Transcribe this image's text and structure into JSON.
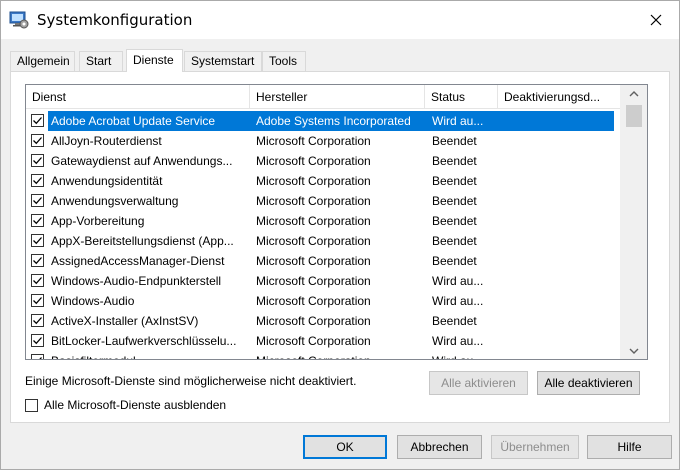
{
  "window": {
    "title": "Systemkonfiguration"
  },
  "tabs": [
    {
      "label": "Allgemein"
    },
    {
      "label": "Start"
    },
    {
      "label": "Dienste"
    },
    {
      "label": "Systemstart"
    },
    {
      "label": "Tools"
    }
  ],
  "active_tab": "Dienste",
  "services": {
    "columns": [
      "Dienst",
      "Hersteller",
      "Status",
      "Deaktivierungsd..."
    ],
    "rows": [
      {
        "name": "Adobe Acrobat Update Service",
        "vendor": "Adobe Systems Incorporated",
        "status": "Wird au...",
        "checked": true,
        "selected": true
      },
      {
        "name": "AllJoyn-Routerdienst",
        "vendor": "Microsoft Corporation",
        "status": "Beendet",
        "checked": true
      },
      {
        "name": "Gatewaydienst auf Anwendungs...",
        "vendor": "Microsoft Corporation",
        "status": "Beendet",
        "checked": true
      },
      {
        "name": "Anwendungsidentität",
        "vendor": "Microsoft Corporation",
        "status": "Beendet",
        "checked": true
      },
      {
        "name": "Anwendungsverwaltung",
        "vendor": "Microsoft Corporation",
        "status": "Beendet",
        "checked": true
      },
      {
        "name": "App-Vorbereitung",
        "vendor": "Microsoft Corporation",
        "status": "Beendet",
        "checked": true
      },
      {
        "name": "AppX-Bereitstellungsdienst (App...",
        "vendor": "Microsoft Corporation",
        "status": "Beendet",
        "checked": true
      },
      {
        "name": "AssignedAccessManager-Dienst",
        "vendor": "Microsoft Corporation",
        "status": "Beendet",
        "checked": true
      },
      {
        "name": "Windows-Audio-Endpunkterstell",
        "vendor": "Microsoft Corporation",
        "status": "Wird au...",
        "checked": true
      },
      {
        "name": "Windows-Audio",
        "vendor": "Microsoft Corporation",
        "status": "Wird au...",
        "checked": true
      },
      {
        "name": "ActiveX-Installer (AxInstSV)",
        "vendor": "Microsoft Corporation",
        "status": "Beendet",
        "checked": true
      },
      {
        "name": "BitLocker-Laufwerkverschlüsselu...",
        "vendor": "Microsoft Corporation",
        "status": "Wird au...",
        "checked": true
      },
      {
        "name": "Basisfiltermodul",
        "vendor": "Microsoft Corporation",
        "status": "Wird au...",
        "checked": true
      }
    ]
  },
  "note": "Einige Microsoft-Dienste sind möglicherweise nicht deaktiviert.",
  "buttons": {
    "enable_all": "Alle aktivieren",
    "disable_all": "Alle deaktivieren",
    "ok": "OK",
    "cancel": "Abbrechen",
    "apply": "Übernehmen",
    "help": "Hilfe"
  },
  "hide_ms_label": "Alle Microsoft-Dienste ausblenden",
  "icons": {
    "app": "msconfig-icon",
    "close": "close-icon",
    "check": "checkmark-icon",
    "scroll_up": "chevron-up-icon",
    "scroll_down": "chevron-down-icon"
  },
  "colors": {
    "selection": "#0078d7"
  }
}
